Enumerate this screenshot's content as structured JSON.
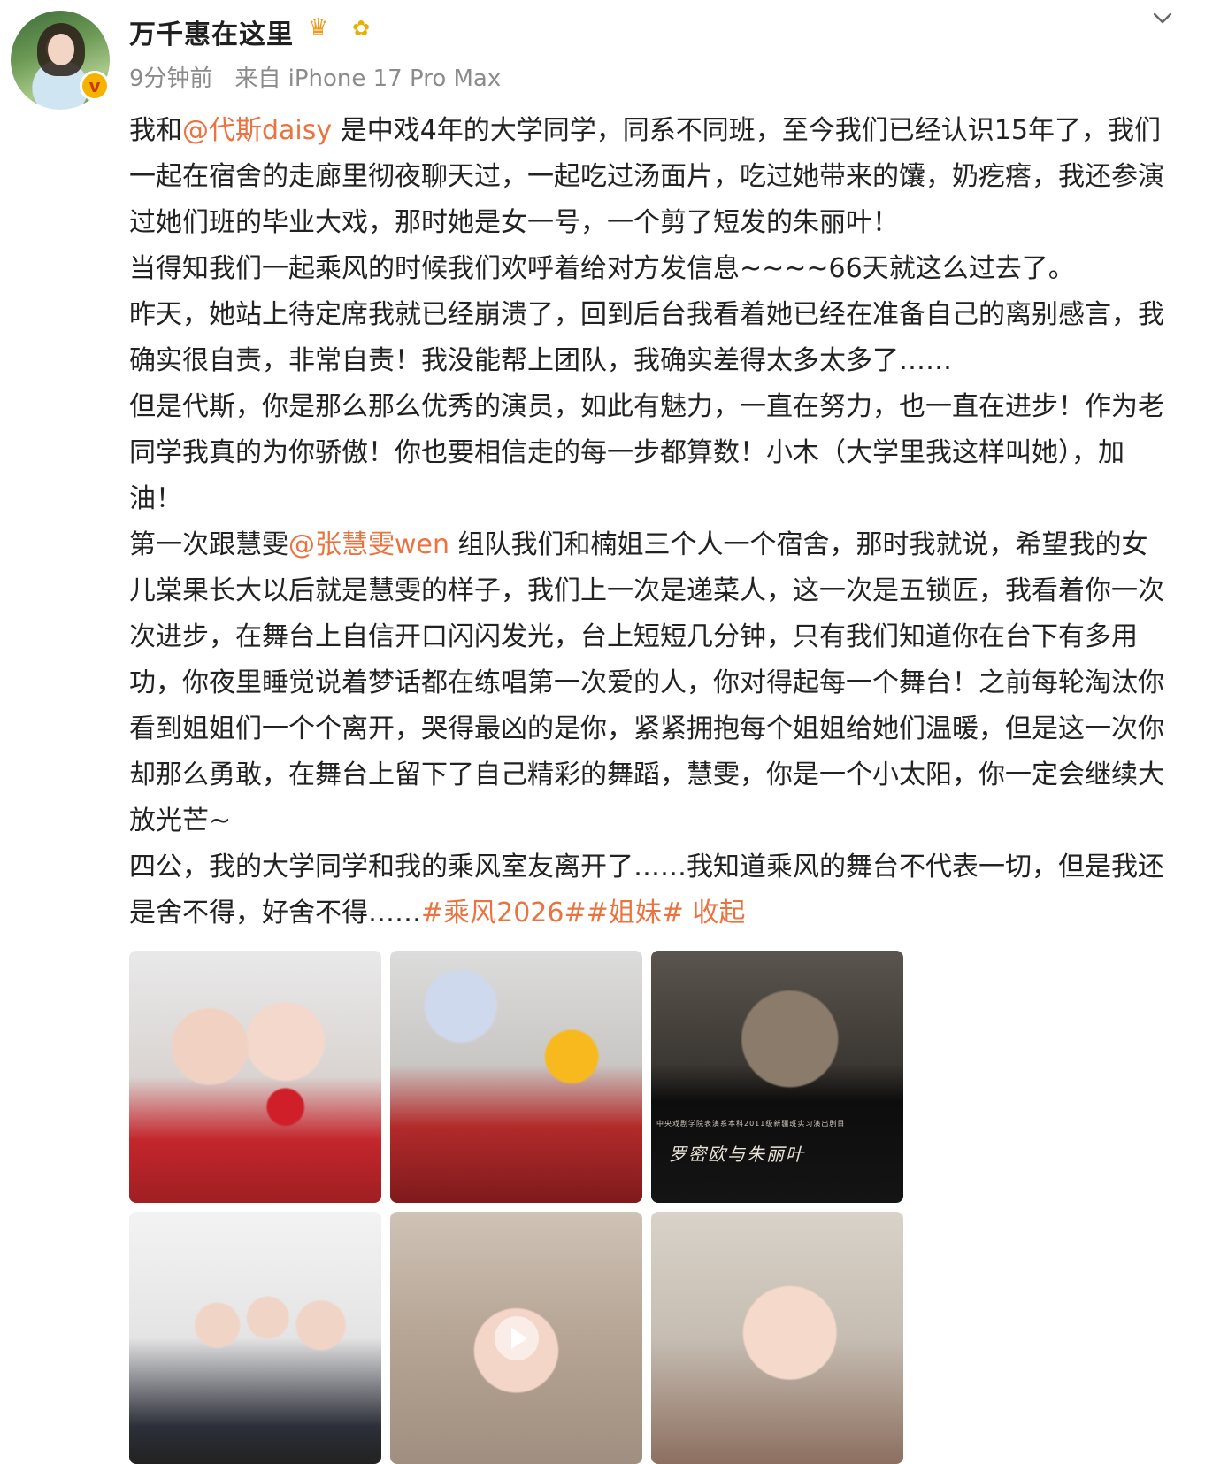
{
  "post": {
    "author": "万千惠在这里",
    "time": "9分钟前",
    "source": "来自 iPhone 17 Pro Max",
    "paragraphs": [
      [
        {
          "t": "我和",
          "type": "text"
        },
        {
          "t": "@代斯daisy",
          "type": "mention"
        },
        {
          "t": " 是中戏4年的大学同学，同系不同班，至今我们已经认识15年了，我们一起在宿舍的走廊里彻夜聊天过，一起吃过汤面片，吃过她带来的馕，奶疙瘩，我还参演过她们班的毕业大戏，那时她是女一号，一个剪了短发的朱丽叶！",
          "type": "text"
        }
      ],
      [
        {
          "t": "当得知我们一起乘风的时候我们欢呼着给对方发信息~~~~66天就这么过去了。",
          "type": "text"
        }
      ],
      [
        {
          "t": "昨天，她站上待定席我就已经崩溃了，回到后台我看着她已经在准备自己的离别感言，我确实很自责，非常自责！我没能帮上团队，我确实差得太多太多了……",
          "type": "text"
        }
      ],
      [
        {
          "t": "但是代斯，你是那么那么优秀的演员，如此有魅力，一直在努力，也一直在进步！作为老同学我真的为你骄傲！你也要相信走的每一步都算数！小木（大学里我这样叫她），加油！",
          "type": "text"
        }
      ],
      [
        {
          "t": "第一次跟慧雯",
          "type": "text"
        },
        {
          "t": "@张慧雯wen",
          "type": "mention"
        },
        {
          "t": " 组队我们和楠姐三个人一个宿舍，那时我就说，希望我的女儿棠果长大以后就是慧雯的样子，我们上一次是递菜人，这一次是五锁匠，我看着你一次次进步，在舞台上自信开口闪闪发光，台上短短几分钟，只有我们知道你在台下有多用功，你夜里睡觉说着梦话都在练唱第一次爱的人，你对得起每一个舞台！之前每轮淘汰你看到姐姐们一个个离开，哭得最凶的是你，紧紧拥抱每个姐姐给她们温暖，但是这一次你却那么勇敢，在舞台上留下了自己精彩的舞蹈，慧雯，你是一个小太阳，你一定会继续大放光芒~",
          "type": "text"
        }
      ],
      [
        {
          "t": "四公，我的大学同学和我的乘风室友离开了……我知道乘风的舞台不代表一切，但是我还是舍不得，好舍不得……",
          "type": "text"
        },
        {
          "t": "#乘风2026#",
          "type": "tag"
        },
        {
          "t": "#姐妹#",
          "type": "tag"
        },
        {
          "t": " 收起",
          "type": "collapse"
        }
      ]
    ],
    "image_caption": "罗密欧与朱丽叶",
    "image_small_caption": "中央戏剧学院表演系本科2011级新疆班实习演出剧目"
  },
  "icons": {
    "avatar": "user-avatar",
    "verified": "verified-badge-icon",
    "crown": "crown-icon",
    "sunflower": "sunflower-icon",
    "more": "chevron-down-icon",
    "play": "play-icon"
  },
  "colors": {
    "link": "#eb7340",
    "meta": "#8b8b8b",
    "text": "#222222",
    "badge": "#f5b300"
  }
}
